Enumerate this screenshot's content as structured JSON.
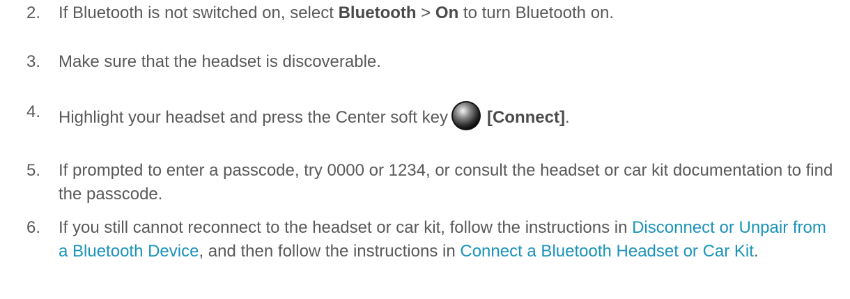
{
  "steps": [
    {
      "number": "2.",
      "text_before": "If Bluetooth is not switched on, select ",
      "bold1": "Bluetooth",
      "separator": " > ",
      "bold2": "On",
      "text_after": " to turn Bluetooth on."
    },
    {
      "number": "3.",
      "text": "Make sure that the headset is discoverable."
    },
    {
      "number": "4.",
      "text_before": "Highlight your headset and press the Center soft key",
      "bold": "[Connect]",
      "text_after": ".",
      "icon": "center-soft-key-icon"
    },
    {
      "number": "5.",
      "text": "If prompted to enter a passcode, try 0000 or 1234, or consult the headset or car kit documentation to find the passcode."
    },
    {
      "number": "6.",
      "text_before": "If you still cannot reconnect to the headset or car kit, follow the instructions in ",
      "link1": "Disconnect or Unpair from a Bluetooth Device",
      "text_middle": ", and then follow the instructions in ",
      "link2": "Connect a Bluetooth Headset or Car Kit",
      "text_after": "."
    }
  ],
  "colors": {
    "text": "#595959",
    "link": "#1a93b8"
  }
}
